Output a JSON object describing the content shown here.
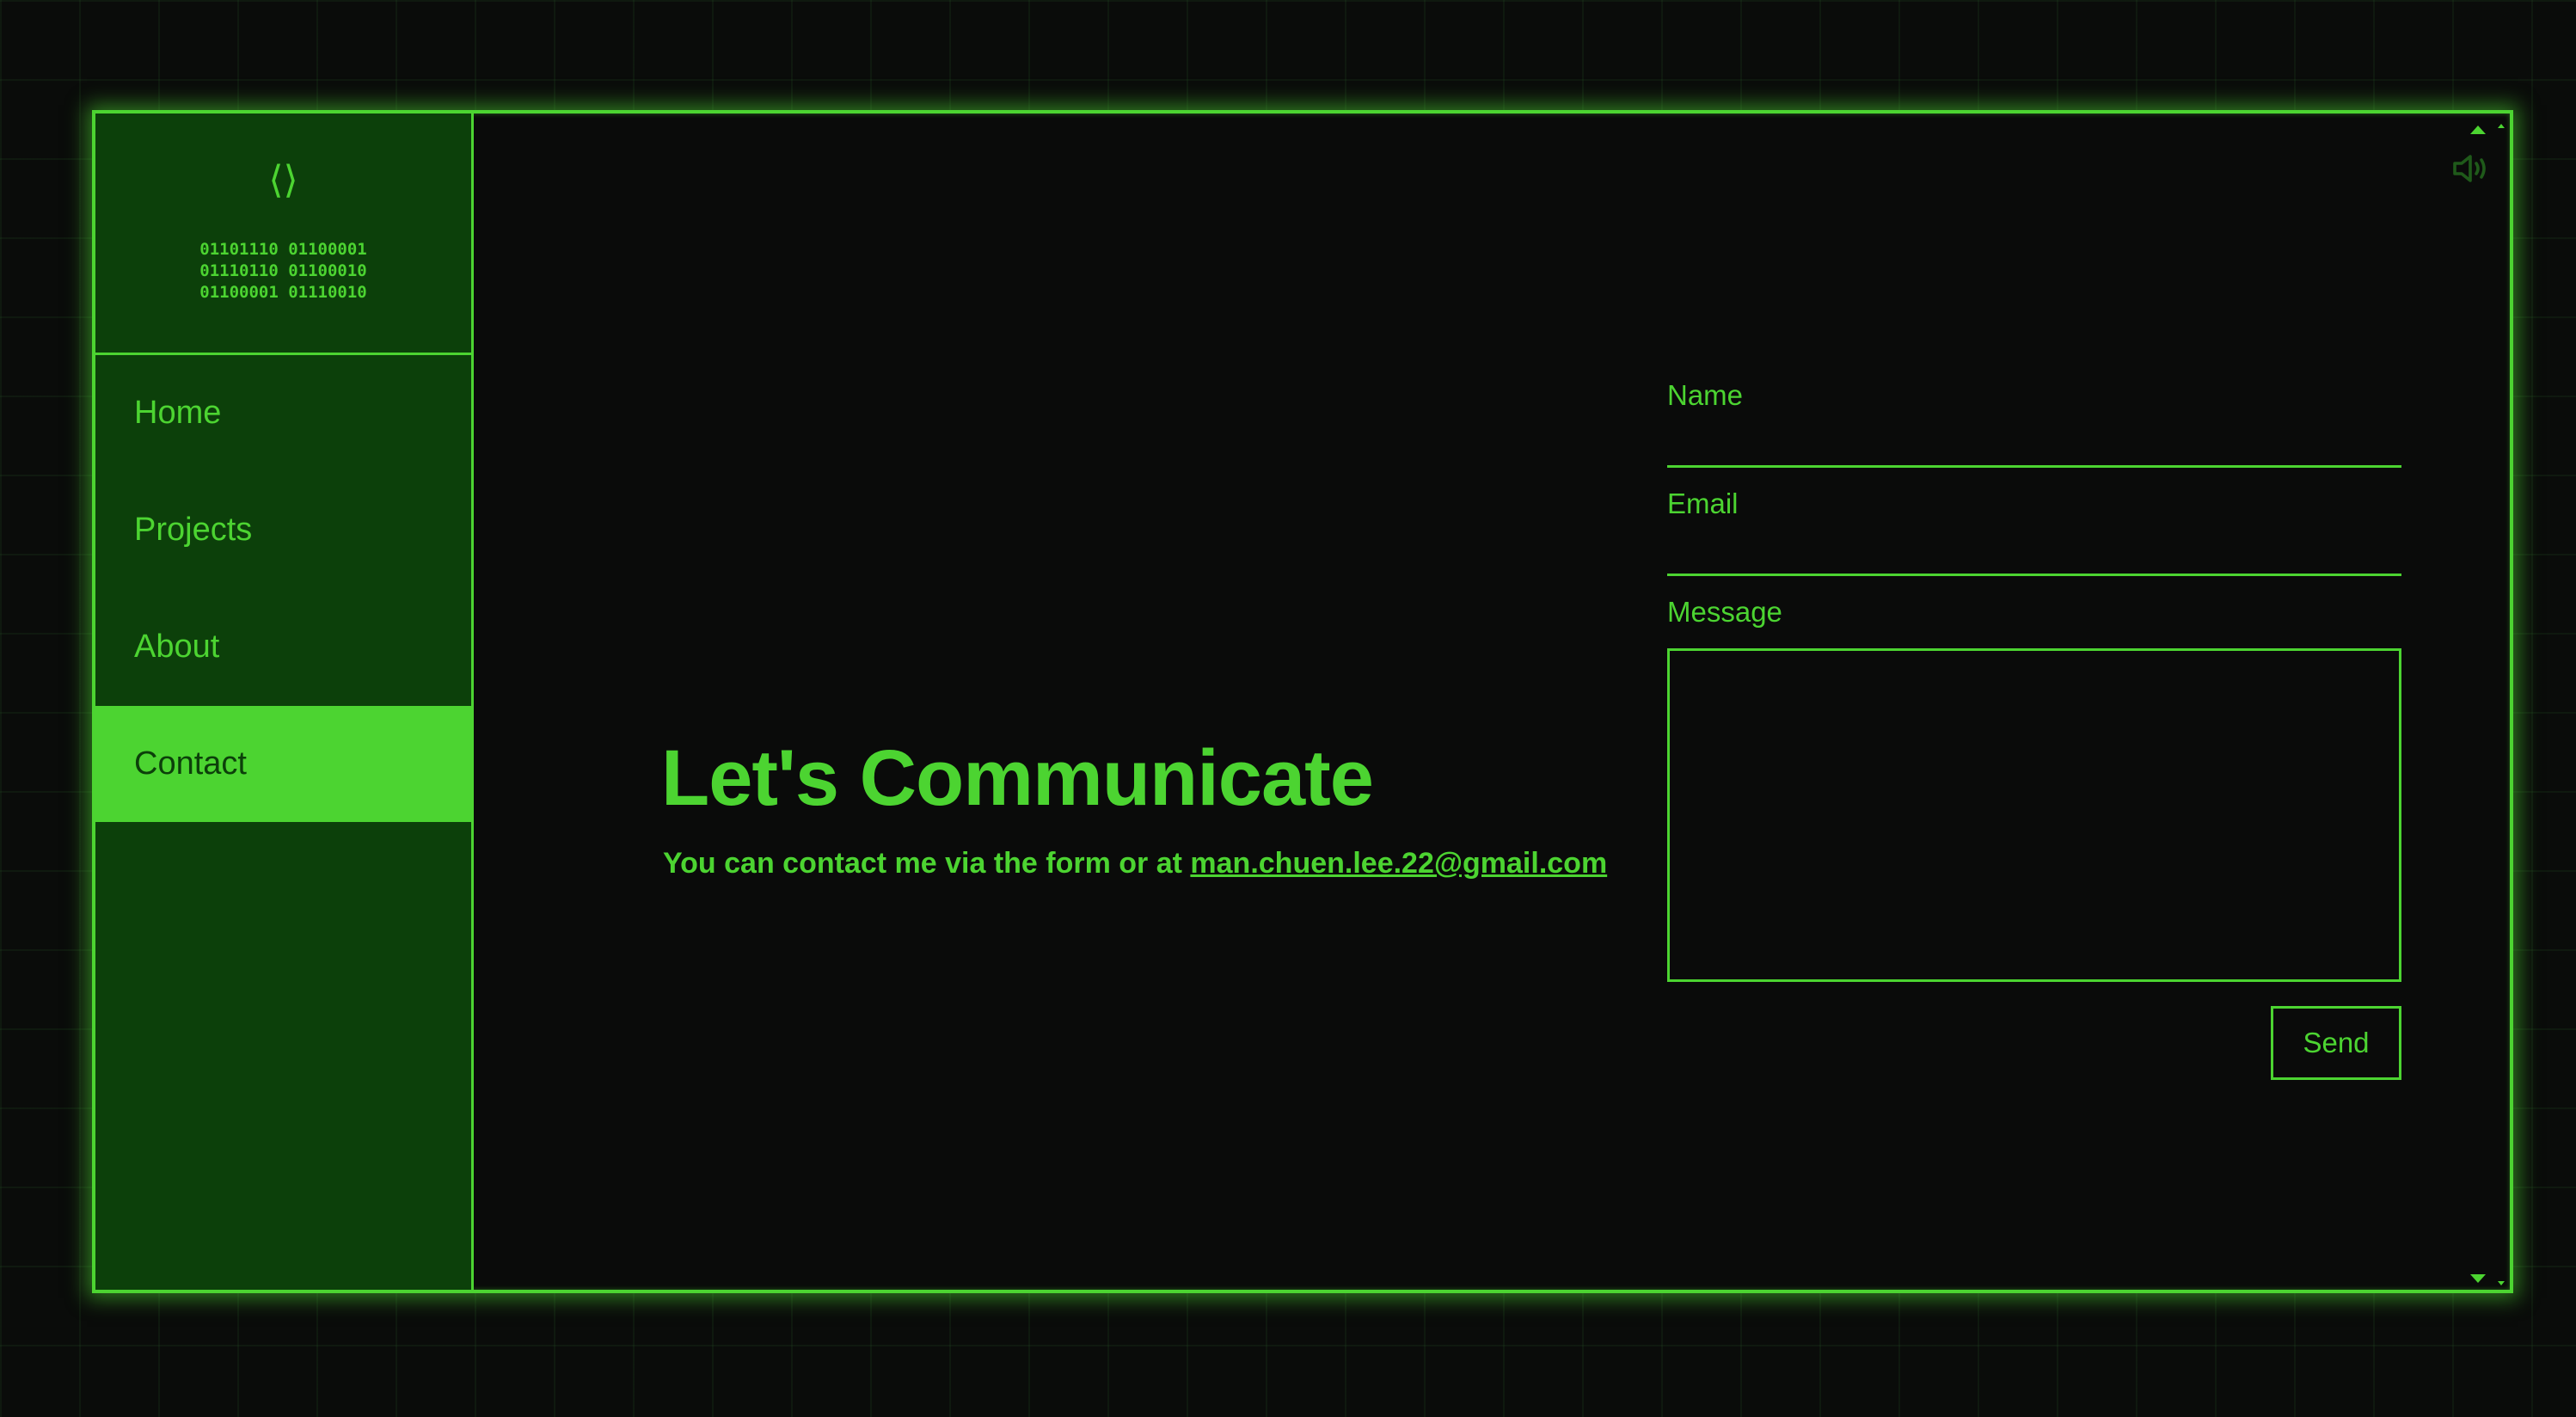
{
  "colors": {
    "accent": "#4cd431",
    "sidebar_bg": "#0c400a",
    "page_bg": "#0a0b0a",
    "muted_icon": "#1f5a1a"
  },
  "sidebar": {
    "logo_icon": "code-brackets-icon",
    "logo_glyph": "⟨⟩",
    "binary_lines": "01101110 01100001\n01110110 01100010\n01100001 01110010",
    "items": [
      {
        "label": "Home",
        "active": false
      },
      {
        "label": "Projects",
        "active": false
      },
      {
        "label": "About",
        "active": false
      },
      {
        "label": "Contact",
        "active": true
      }
    ]
  },
  "main": {
    "heading": "Let's Communicate",
    "subtext_prefix": "You can contact me via the form or at ",
    "email_link": "man.chuen.lee.22@gmail.com"
  },
  "form": {
    "name_label": "Name",
    "name_value": "",
    "email_label": "Email",
    "email_value": "",
    "message_label": "Message",
    "message_value": "",
    "send_label": "Send"
  },
  "controls": {
    "volume_icon": "volume-icon",
    "scroll_up_icon": "scroll-up-arrow-icon",
    "scroll_down_icon": "scroll-down-arrow-icon"
  }
}
